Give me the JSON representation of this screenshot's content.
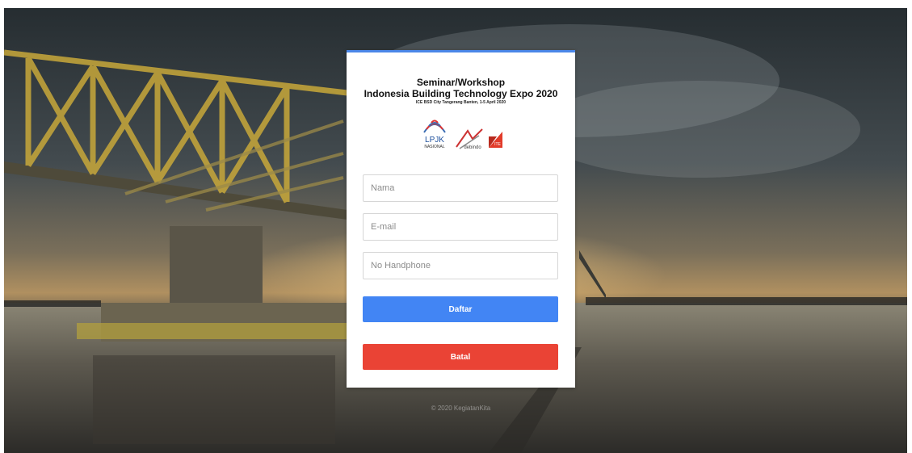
{
  "card": {
    "title": "Seminar/Workshop",
    "subtitle": "Indonesia Building Technology Expo 2020",
    "venue": "ICE BSD City Tangerang Banten, 1-5 April 2020"
  },
  "logos": {
    "lpjk": "LPJK",
    "lpjk_sub": "NASIONAL",
    "debindo": "debindo",
    "ite": "ITE"
  },
  "form": {
    "name_placeholder": "Nama",
    "email_placeholder": "E-mail",
    "phone_placeholder": "No Handphone",
    "submit_label": "Daftar",
    "cancel_label": "Batal"
  },
  "footer": {
    "copyright": "© 2020 KegiatanKita"
  },
  "colors": {
    "accent": "#4a86e8",
    "primary_button": "#4285f4",
    "danger_button": "#ea4335"
  }
}
